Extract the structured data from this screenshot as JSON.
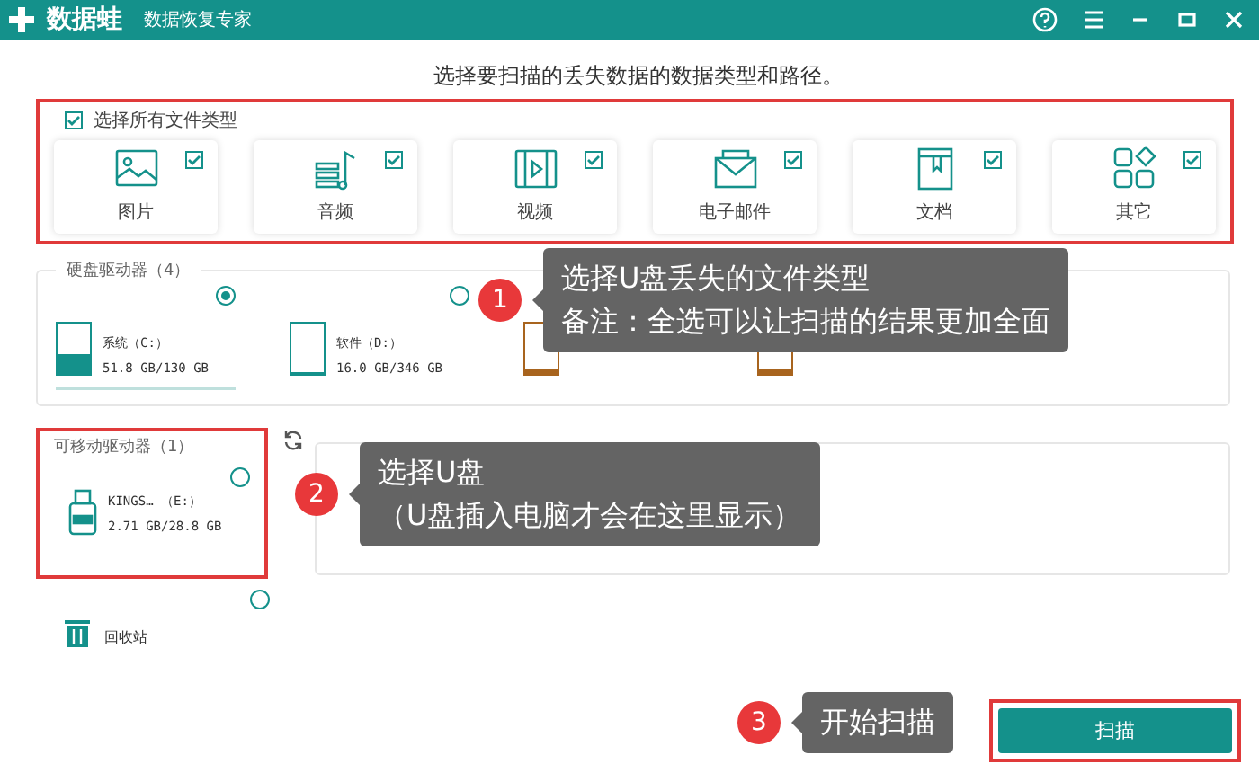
{
  "app": {
    "name": "数据蛙",
    "subtitle": "数据恢复专家"
  },
  "heading": "选择要扫描的丢失数据的数据类型和路径。",
  "file_types": {
    "select_all": {
      "label": "选择所有文件类型",
      "checked": true
    },
    "items": [
      {
        "kind": "image",
        "label": "图片",
        "checked": true
      },
      {
        "kind": "audio",
        "label": "音频",
        "checked": true
      },
      {
        "kind": "video",
        "label": "视频",
        "checked": true
      },
      {
        "kind": "email",
        "label": "电子邮件",
        "checked": true
      },
      {
        "kind": "document",
        "label": "文档",
        "checked": true
      },
      {
        "kind": "other",
        "label": "其它",
        "checked": true
      }
    ]
  },
  "hard_drives": {
    "title": "硬盘驱动器（4）",
    "items": [
      {
        "kind": "system",
        "name": "系统（C:）",
        "size": "51.8 GB/130 GB",
        "level": 0.4,
        "selected": true
      },
      {
        "kind": "plain",
        "name": "软件（D:）",
        "size": "16.0 GB/346 GB",
        "level": 0.05,
        "selected": false
      },
      {
        "kind": "covered",
        "level": 0.1
      },
      {
        "kind": "covered",
        "level": 0.1
      }
    ]
  },
  "removable": {
    "title": "可移动驱动器（1）",
    "items": [
      {
        "name": "KINGS… （E:）",
        "size": "2.71 GB/28.8 GB",
        "selected": false
      }
    ]
  },
  "recycle_bin": {
    "label": "回收站",
    "selected": false
  },
  "scan_button": "扫描",
  "callouts": [
    {
      "number": "1",
      "lines": [
        "选择U盘丢失的文件类型",
        "备注：全选可以让扫描的结果更加全面"
      ]
    },
    {
      "number": "2",
      "lines": [
        "选择U盘",
        "（U盘插入电脑才会在这里显示）"
      ]
    },
    {
      "number": "3",
      "lines": [
        "开始扫描"
      ]
    }
  ]
}
